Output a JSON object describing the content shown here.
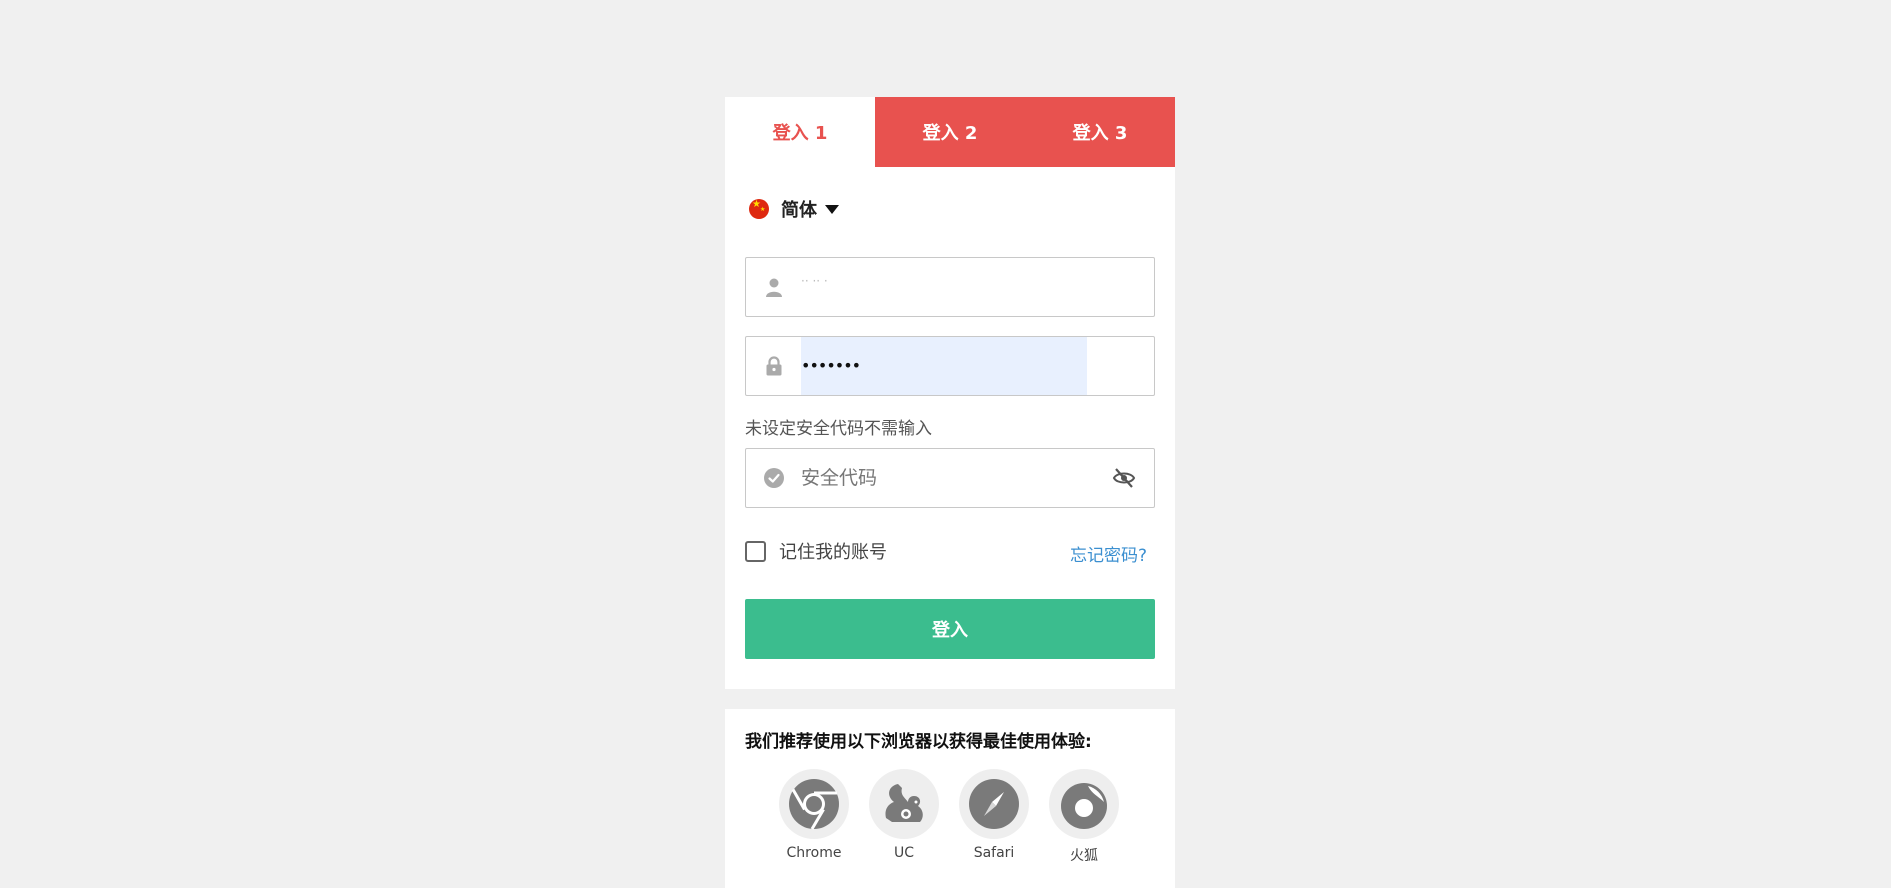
{
  "tabs": [
    {
      "label": "登入 1",
      "active": true
    },
    {
      "label": "登入 2",
      "active": false
    },
    {
      "label": "登入 3",
      "active": false
    }
  ],
  "language": {
    "label": "简体",
    "flag": "china-flag-icon"
  },
  "username": {
    "value": "·· ·· ·",
    "icon": "user-icon"
  },
  "password": {
    "value": "•••••••",
    "icon": "lock-icon"
  },
  "security_code": {
    "hint": "未设定安全代码不需输入",
    "placeholder": "安全代码",
    "icon": "check-circle-icon",
    "toggle_icon": "eye-slash-icon"
  },
  "remember": {
    "label": "记住我的账号",
    "checked": false
  },
  "forgot_label": "忘记密码?",
  "login_label": "登入",
  "browsers": {
    "title": "我们推荐使用以下浏览器以获得最佳使用体验:",
    "items": [
      {
        "name": "Chrome",
        "icon": "chrome-icon"
      },
      {
        "name": "UC",
        "icon": "uc-browser-icon"
      },
      {
        "name": "Safari",
        "icon": "safari-icon"
      },
      {
        "name": "火狐",
        "icon": "firefox-icon"
      }
    ]
  },
  "colors": {
    "accent": "#e8524f",
    "button": "#3bbd8e",
    "link": "#3b8fd0",
    "background": "#f0f0f0",
    "autofill": "#e8f0fe"
  }
}
